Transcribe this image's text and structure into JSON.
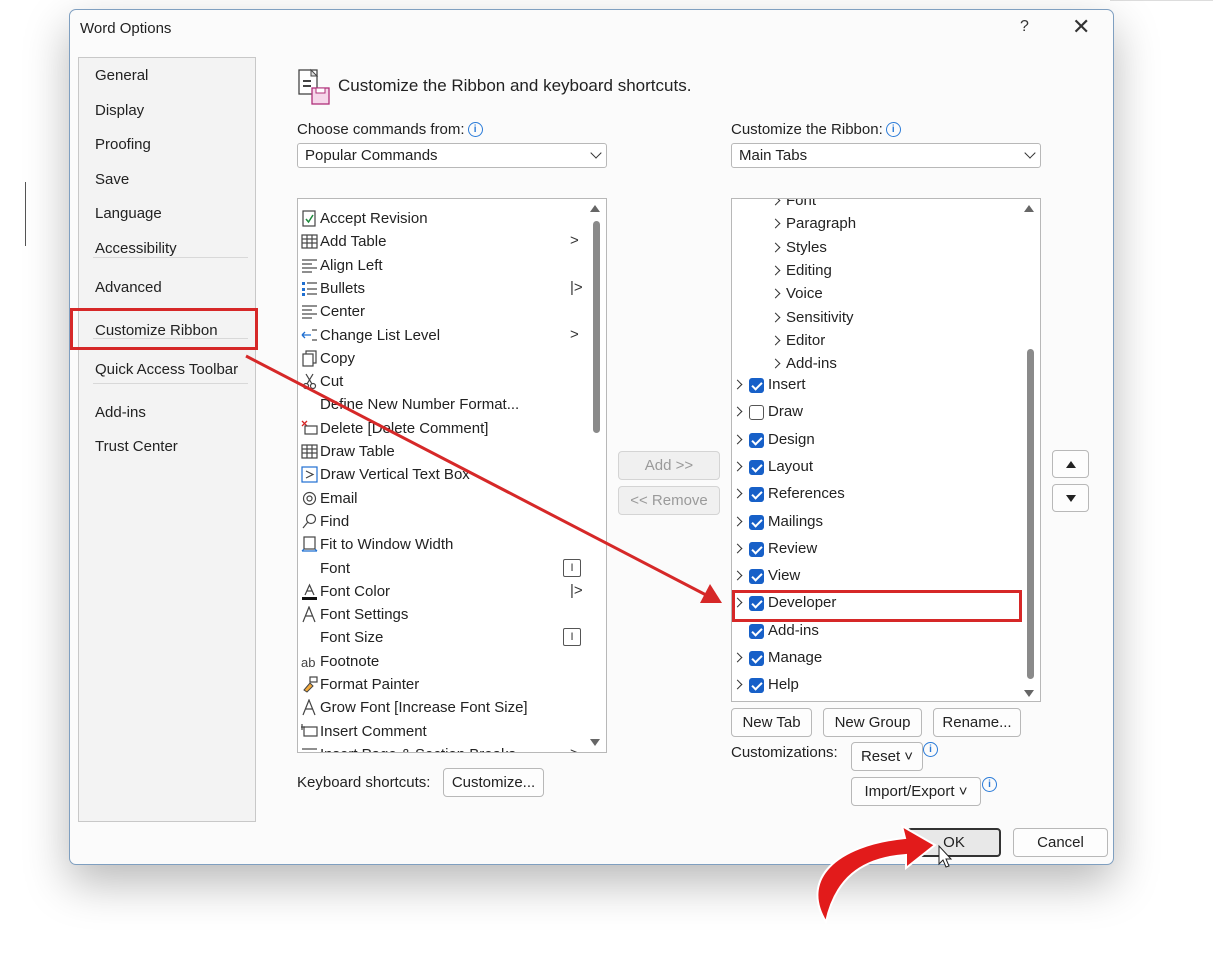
{
  "dialog": {
    "title": "Word Options",
    "help": "?",
    "close": "✕"
  },
  "sidebar": {
    "items": [
      {
        "label": "General"
      },
      {
        "label": "Display"
      },
      {
        "label": "Proofing"
      },
      {
        "label": "Save"
      },
      {
        "label": "Language"
      },
      {
        "label": "Accessibility"
      },
      {
        "label": "Advanced"
      },
      {
        "label": "Customize Ribbon"
      },
      {
        "label": "Quick Access Toolbar"
      },
      {
        "label": "Add-ins"
      },
      {
        "label": "Trust Center"
      }
    ],
    "selected": "Customize Ribbon"
  },
  "main": {
    "heading": "Customize the Ribbon and keyboard shortcuts.",
    "choose_label": "Choose commands from:",
    "choose_value": "Popular Commands",
    "ribbon_label": "Customize the Ribbon:",
    "ribbon_value": "Main Tabs",
    "commands": [
      {
        "label": "Accept Revision",
        "icon": "accept-revision-icon"
      },
      {
        "label": "Add Table",
        "icon": "table-icon",
        "sub": ">"
      },
      {
        "label": "Align Left",
        "icon": "align-left-icon"
      },
      {
        "label": "Bullets",
        "icon": "bullets-icon",
        "sub": "|>"
      },
      {
        "label": "Center",
        "icon": "align-center-icon"
      },
      {
        "label": "Change List Level",
        "icon": "list-level-icon",
        "sub": ">"
      },
      {
        "label": "Copy",
        "icon": "copy-icon"
      },
      {
        "label": "Cut",
        "icon": "scissors-icon"
      },
      {
        "label": "Define New Number Format...",
        "icon": ""
      },
      {
        "label": "Delete [Delete Comment]",
        "icon": "delete-comment-icon"
      },
      {
        "label": "Draw Table",
        "icon": "draw-table-icon"
      },
      {
        "label": "Draw Vertical Text Box",
        "icon": "text-box-icon"
      },
      {
        "label": "Email",
        "icon": "email-icon"
      },
      {
        "label": "Find",
        "icon": "search-icon"
      },
      {
        "label": "Fit to Window Width",
        "icon": "fit-width-icon"
      },
      {
        "label": "Font",
        "icon": "",
        "subbox": "I"
      },
      {
        "label": "Font Color",
        "icon": "font-color-icon",
        "sub": "|>"
      },
      {
        "label": "Font Settings",
        "icon": "font-settings-icon"
      },
      {
        "label": "Font Size",
        "icon": "",
        "subbox": "I"
      },
      {
        "label": "Footnote",
        "icon": "footnote-icon"
      },
      {
        "label": "Format Painter",
        "icon": "format-painter-icon"
      },
      {
        "label": "Grow Font [Increase Font Size]",
        "icon": "grow-font-icon"
      },
      {
        "label": "Insert Comment",
        "icon": "insert-comment-icon"
      },
      {
        "label": "Insert Page & Section Breaks",
        "icon": "page-break-icon",
        "sub": ">"
      }
    ],
    "add_button": "Add >>",
    "remove_button": "<< Remove",
    "tree": [
      {
        "label": "Font",
        "level": 2,
        "partial": true
      },
      {
        "label": "Paragraph",
        "level": 2
      },
      {
        "label": "Styles",
        "level": 2
      },
      {
        "label": "Editing",
        "level": 2
      },
      {
        "label": "Voice",
        "level": 2
      },
      {
        "label": "Sensitivity",
        "level": 2
      },
      {
        "label": "Editor",
        "level": 2
      },
      {
        "label": "Add-ins",
        "level": 2
      },
      {
        "label": "Insert",
        "level": 1,
        "checked": true,
        "expander": true
      },
      {
        "label": "Draw",
        "level": 1,
        "checked": false,
        "expander": true
      },
      {
        "label": "Design",
        "level": 1,
        "checked": true,
        "expander": true
      },
      {
        "label": "Layout",
        "level": 1,
        "checked": true,
        "expander": true
      },
      {
        "label": "References",
        "level": 1,
        "checked": true,
        "expander": true
      },
      {
        "label": "Mailings",
        "level": 1,
        "checked": true,
        "expander": true
      },
      {
        "label": "Review",
        "level": 1,
        "checked": true,
        "expander": true
      },
      {
        "label": "View",
        "level": 1,
        "checked": true,
        "expander": true
      },
      {
        "label": "Developer",
        "level": 1,
        "checked": true,
        "expander": true
      },
      {
        "label": "Add-ins",
        "level": 1,
        "checked": true,
        "expander": false
      },
      {
        "label": "Manage",
        "level": 1,
        "checked": true,
        "expander": true
      },
      {
        "label": "Help",
        "level": 1,
        "checked": true,
        "expander": true
      }
    ],
    "new_tab": "New Tab",
    "new_group": "New Group",
    "rename": "Rename...",
    "customizations_label": "Customizations:",
    "reset": "Reset ˅",
    "import_export": "Import/Export ˅",
    "keyboard_label": "Keyboard shortcuts:",
    "customize_button": "Customize...",
    "ok": "OK",
    "cancel": "Cancel"
  },
  "colors": {
    "annotation_red": "#d62828",
    "checkbox_blue": "#1760c8"
  }
}
